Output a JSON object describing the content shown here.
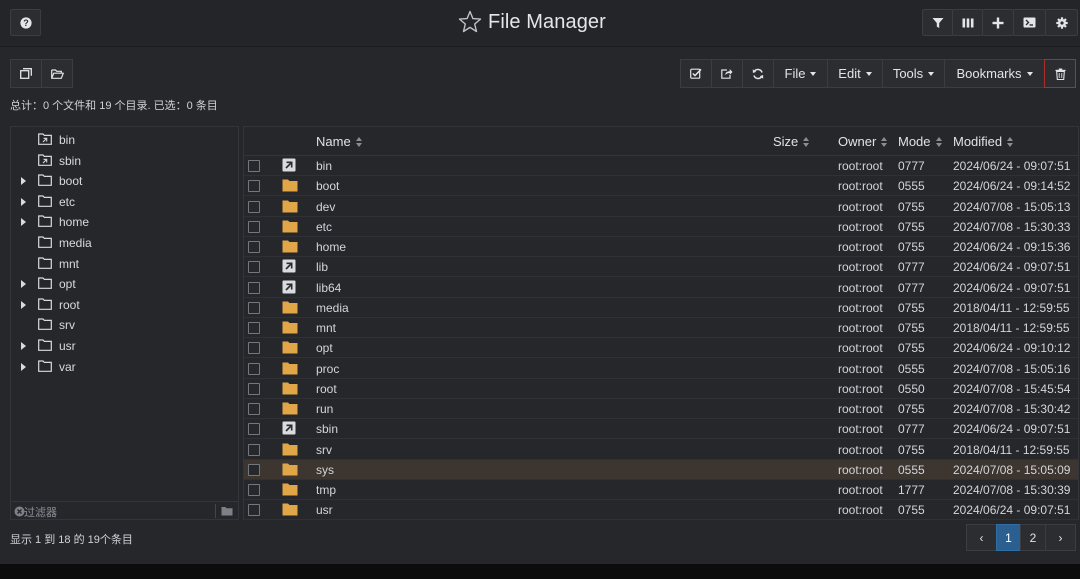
{
  "app": {
    "title": "File Manager"
  },
  "topbar": {
    "left_icon": "question-icon",
    "right_icons": [
      "filter-icon",
      "columns-icon",
      "plus-icon",
      "terminal-icon",
      "gear-icon"
    ]
  },
  "toolbar": {
    "left_buttons": [
      "copy-icon",
      "folder-open-icon"
    ],
    "right_icon_buttons": [
      "check-square-icon",
      "share-icon",
      "refresh-icon"
    ],
    "menus": [
      {
        "label": "File"
      },
      {
        "label": "Edit"
      },
      {
        "label": "Tools"
      },
      {
        "label": "Bookmarks"
      }
    ],
    "trash_icon": "trash-icon"
  },
  "summary": "总计：0 个文件和 19 个目录. 已选：0 条目",
  "tree": [
    {
      "label": "bin",
      "link": true,
      "expandable": false
    },
    {
      "label": "sbin",
      "link": true,
      "expandable": false
    },
    {
      "label": "boot",
      "link": false,
      "expandable": true
    },
    {
      "label": "etc",
      "link": false,
      "expandable": true
    },
    {
      "label": "home",
      "link": false,
      "expandable": true
    },
    {
      "label": "media",
      "link": false,
      "expandable": false
    },
    {
      "label": "mnt",
      "link": false,
      "expandable": false
    },
    {
      "label": "opt",
      "link": false,
      "expandable": true
    },
    {
      "label": "root",
      "link": false,
      "expandable": true
    },
    {
      "label": "srv",
      "link": false,
      "expandable": false
    },
    {
      "label": "usr",
      "link": false,
      "expandable": true
    },
    {
      "label": "var",
      "link": false,
      "expandable": true
    }
  ],
  "filter": {
    "placeholder": "过滤器"
  },
  "columns": {
    "name": "Name",
    "size": "Size",
    "owner": "Owner",
    "mode": "Mode",
    "modified": "Modified"
  },
  "files": [
    {
      "name": "bin",
      "link": true,
      "size": "",
      "owner": "root:root",
      "mode": "0777",
      "modified": "2024/06/24 - 09:07:51"
    },
    {
      "name": "boot",
      "link": false,
      "size": "",
      "owner": "root:root",
      "mode": "0555",
      "modified": "2024/06/24 - 09:14:52"
    },
    {
      "name": "dev",
      "link": false,
      "size": "",
      "owner": "root:root",
      "mode": "0755",
      "modified": "2024/07/08 - 15:05:13"
    },
    {
      "name": "etc",
      "link": false,
      "size": "",
      "owner": "root:root",
      "mode": "0755",
      "modified": "2024/07/08 - 15:30:33"
    },
    {
      "name": "home",
      "link": false,
      "size": "",
      "owner": "root:root",
      "mode": "0755",
      "modified": "2024/06/24 - 09:15:36"
    },
    {
      "name": "lib",
      "link": true,
      "size": "",
      "owner": "root:root",
      "mode": "0777",
      "modified": "2024/06/24 - 09:07:51"
    },
    {
      "name": "lib64",
      "link": true,
      "size": "",
      "owner": "root:root",
      "mode": "0777",
      "modified": "2024/06/24 - 09:07:51"
    },
    {
      "name": "media",
      "link": false,
      "size": "",
      "owner": "root:root",
      "mode": "0755",
      "modified": "2018/04/11 - 12:59:55"
    },
    {
      "name": "mnt",
      "link": false,
      "size": "",
      "owner": "root:root",
      "mode": "0755",
      "modified": "2018/04/11 - 12:59:55"
    },
    {
      "name": "opt",
      "link": false,
      "size": "",
      "owner": "root:root",
      "mode": "0755",
      "modified": "2024/06/24 - 09:10:12"
    },
    {
      "name": "proc",
      "link": false,
      "size": "",
      "owner": "root:root",
      "mode": "0555",
      "modified": "2024/07/08 - 15:05:16"
    },
    {
      "name": "root",
      "link": false,
      "size": "",
      "owner": "root:root",
      "mode": "0550",
      "modified": "2024/07/08 - 15:45:54"
    },
    {
      "name": "run",
      "link": false,
      "size": "",
      "owner": "root:root",
      "mode": "0755",
      "modified": "2024/07/08 - 15:30:42"
    },
    {
      "name": "sbin",
      "link": true,
      "size": "",
      "owner": "root:root",
      "mode": "0777",
      "modified": "2024/06/24 - 09:07:51"
    },
    {
      "name": "srv",
      "link": false,
      "size": "",
      "owner": "root:root",
      "mode": "0755",
      "modified": "2018/04/11 - 12:59:55"
    },
    {
      "name": "sys",
      "link": false,
      "size": "",
      "owner": "root:root",
      "mode": "0555",
      "modified": "2024/07/08 - 15:05:09",
      "highlighted": true
    },
    {
      "name": "tmp",
      "link": false,
      "size": "",
      "owner": "root:root",
      "mode": "1777",
      "modified": "2024/07/08 - 15:30:39"
    },
    {
      "name": "usr",
      "link": false,
      "size": "",
      "owner": "root:root",
      "mode": "0755",
      "modified": "2024/06/24 - 09:07:51"
    }
  ],
  "footer": {
    "info": "显示 1 到 18 的 19个条目"
  },
  "pagination": {
    "prev": "‹",
    "pages": [
      "1",
      "2"
    ],
    "current": "1",
    "next": "›"
  },
  "colors": {
    "folder": "#dfa649",
    "active_page": "#2a5f8f",
    "danger": "#c0392b"
  }
}
